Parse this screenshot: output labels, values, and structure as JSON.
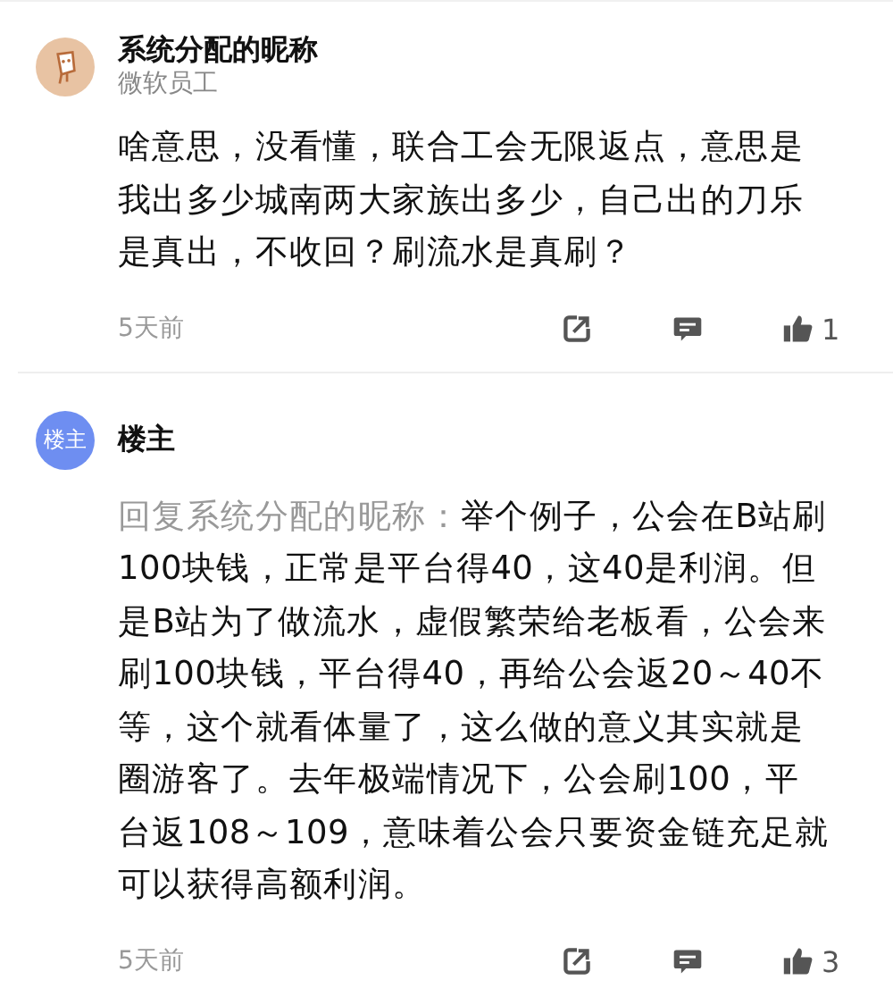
{
  "comments": [
    {
      "author": "系统分配的昵称",
      "subtitle": "微软员工",
      "text": "啥意思，没看懂，联合工会无限返点，意思是我出多少城南两大家族出多少，自己出的刀乐是真出，不收回？刷流水是真刷？",
      "time": "5天前",
      "likes": "1"
    },
    {
      "avatar": {
        "kind": "badge",
        "label": "楼主"
      },
      "author": "楼主",
      "reply_to": "回复系统分配的昵称：",
      "text": "举个例子，公会在B站刷100块钱，正常是平台得40，这40是利润。但是B站为了做流水，虚假繁荣给老板看，公会来刷100块钱，平台得40，再给公会返20～40不等，这个就看体量了，这么做的意义其实就是圈游客了。去年极端情况下，公会刷100，平台返108～109，意味着公会只要资金链充足就可以获得高额利润。",
      "time": "5天前",
      "likes": "3"
    }
  ]
}
